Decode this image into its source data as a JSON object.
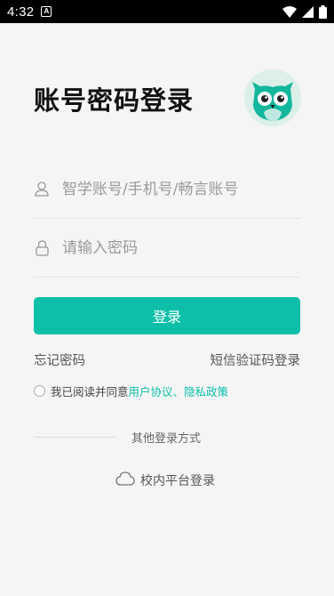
{
  "status_bar": {
    "time": "4:32",
    "notification_badge": "A"
  },
  "page_title": "账号密码登录",
  "account_field": {
    "placeholder": "智学账号/手机号/畅言账号",
    "value": ""
  },
  "password_field": {
    "placeholder": "请输入密码",
    "value": ""
  },
  "login_button_label": "登录",
  "forgot_password": "忘记密码",
  "sms_login": "短信验证码登录",
  "agreement": {
    "prefix": "我已阅读并同意",
    "user_agreement": "用户协议",
    "separator": "、",
    "privacy_policy": "隐私政策"
  },
  "other_login_label": "其他登录方式",
  "campus_login_label": "校内平台登录",
  "colors": {
    "accent": "#0dbfa9",
    "background": "#f5f5f5"
  }
}
